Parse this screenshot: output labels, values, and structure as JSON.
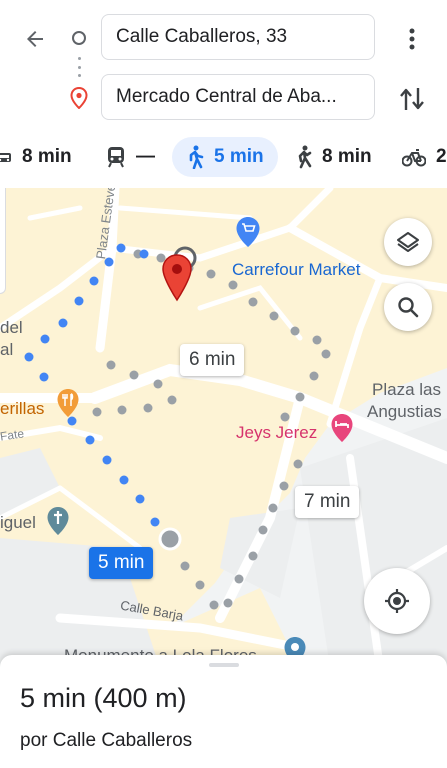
{
  "search": {
    "origin_value": "Calle Caballeros, 33",
    "destination_value": "Mercado Central de Aba..."
  },
  "modes": [
    {
      "icon": "car-icon",
      "label": "8 min",
      "active": false
    },
    {
      "icon": "transit-icon",
      "label": "—",
      "active": false
    },
    {
      "icon": "walk-icon",
      "label": "5 min",
      "active": true
    },
    {
      "icon": "ride-icon",
      "label": "8 min",
      "active": false
    },
    {
      "icon": "bike-icon",
      "label": "2",
      "active": false
    }
  ],
  "map": {
    "places": {
      "carrefour": "Carrefour Market",
      "plaza_line1": "Plaza las",
      "plaza_line2": "Angustias",
      "jeys": "Jeys Jerez",
      "plaza_esteve": "Plaza Esteve",
      "del": "del",
      "al": "al",
      "erillas": "erillas",
      "fate": "Fate",
      "iguel": "iguel",
      "calle_barja": "Calle Barja",
      "monumento": "Monumento a Lola Flores"
    },
    "route_labels": {
      "alt1": "6 min",
      "alt2": "7 min",
      "selected": "5 min"
    }
  },
  "summary": {
    "title": "5 min  (400 m)",
    "via": "por Calle Caballeros"
  },
  "colors": {
    "accent": "#1a73e8",
    "route_dot": "#4285f4",
    "alt_dot": "#9aa0a6",
    "pin": "#ea4335",
    "shop": "#4285f4",
    "hotel": "#e8457c",
    "restaurant": "#f29c38",
    "map_yellow": "#fdf3d5"
  }
}
